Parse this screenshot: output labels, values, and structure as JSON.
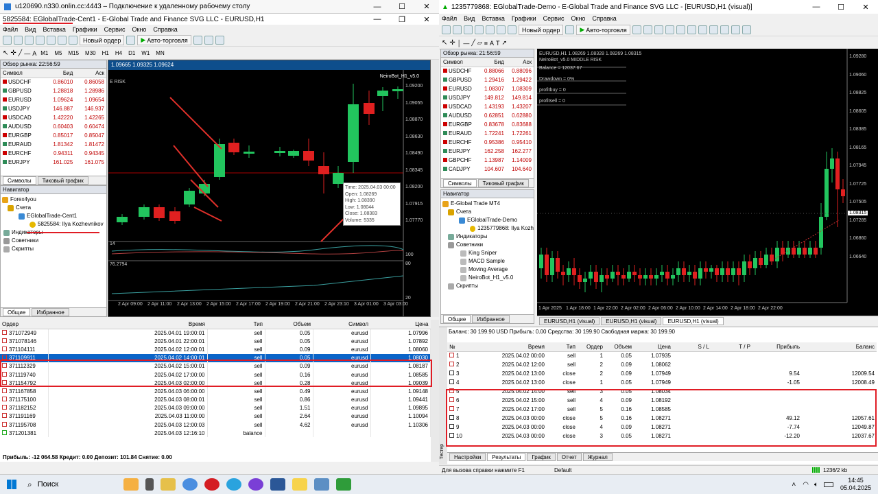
{
  "rdp": {
    "title": "u120690.n330.onlin.cc:4443 – Подключение к удаленному рабочему столу"
  },
  "left": {
    "title": "5825584: EGlobalTrade-Cent1 - E-Global Trade and Finance SVG LLC - EURUSD,H1",
    "menu": [
      "Файл",
      "Вид",
      "Вставка",
      "Графики",
      "Сервис",
      "Окно",
      "Справка"
    ],
    "new_order": "Новый ордер",
    "autotrade": "Авто-торговля",
    "timeframes": [
      "M1",
      "M5",
      "M15",
      "M30",
      "H1",
      "H4",
      "D1",
      "W1",
      "MN"
    ],
    "mw_header": "Обзор рынка: 22:56:59",
    "mw_cols": [
      "Символ",
      "Бид",
      "Аск"
    ],
    "mw_rows": [
      [
        "USDCHF",
        "0.86010",
        "0.86058"
      ],
      [
        "GBPUSD",
        "1.28818",
        "1.28986"
      ],
      [
        "EURUSD",
        "1.09624",
        "1.09654"
      ],
      [
        "USDJPY",
        "146.887",
        "146.937"
      ],
      [
        "USDCAD",
        "1.42220",
        "1.42265"
      ],
      [
        "AUDUSD",
        "0.60403",
        "0.60474"
      ],
      [
        "EURGBP",
        "0.85017",
        "0.85047"
      ],
      [
        "EURAUD",
        "1.81342",
        "1.81472"
      ],
      [
        "EURCHF",
        "0.94311",
        "0.94345"
      ],
      [
        "EURJPY",
        "161.025",
        "161.075"
      ]
    ],
    "mw_tabs": [
      "Символы",
      "Тиковый график"
    ],
    "nav_header": "Навигатор",
    "nav": [
      "Forex4you",
      "Счета",
      "EGlobalTrade-Cent1",
      "5825584: Ilya Kozhevnikov",
      "Индикаторы",
      "Советники",
      "Скрипты"
    ],
    "nav_tabs": [
      "Общие",
      "Избранное"
    ],
    "chart_header": "1.09665 1.09325 1.09624",
    "chart_risk": "E RISK",
    "chart_bot": "NeiroBot_H1_v5.0",
    "price_labels": [
      "1.09200",
      "1.09055",
      "1.08870",
      "1.08630",
      "1.08490",
      "1.08345",
      "1.08200",
      "1.07915",
      "1.07770",
      "100",
      "80",
      "20"
    ],
    "tooltip": [
      "Time: 2025.04.03 00:00",
      "Open: 1.08269",
      "High: 1.08390",
      "Low: 1.08044",
      "Close: 1.08383",
      "Volume: 5335"
    ],
    "ind_value": "76.2794",
    "ind_level": "14",
    "time_labels": [
      "2 Apr 09:00",
      "2 Apr 11:00",
      "2 Apr 13:00",
      "2 Apr 15:00",
      "2 Apr 17:00",
      "2 Apr 19:00",
      "2 Apr 21:00",
      "2 Apr 23:10",
      "3 Apr 01:00",
      "3 Apr 03:00"
    ],
    "orders_cols": [
      "Ордер",
      "Время",
      "Тип",
      "Объем",
      "Символ",
      "Цена"
    ],
    "orders": [
      [
        "371072949",
        "2025.04.01 19:00:01",
        "sell",
        "0.05",
        "eurusd",
        "1.07996"
      ],
      [
        "371078146",
        "2025.04.01 22:00:01",
        "sell",
        "0.05",
        "eurusd",
        "1.07892"
      ],
      [
        "371104111",
        "2025.04.02 12:00:01",
        "sell",
        "0.09",
        "eurusd",
        "1.08060"
      ],
      [
        "371109911",
        "2025.04.02 14:00:01",
        "sell",
        "0.05",
        "eurusd",
        "1.08030"
      ],
      [
        "371112329",
        "2025.04.02 15:00:01",
        "sell",
        "0.09",
        "eurusd",
        "1.08187"
      ],
      [
        "371119740",
        "2025.04.02 17:00:00",
        "sell",
        "0.16",
        "eurusd",
        "1.08585"
      ],
      [
        "371154792",
        "2025.04.03 02:00:00",
        "sell",
        "0.28",
        "eurusd",
        "1.09039"
      ],
      [
        "371167858",
        "2025.04.03 06:00:00",
        "sell",
        "0.49",
        "eurusd",
        "1.09148"
      ],
      [
        "371175100",
        "2025.04.03 08:00:01",
        "sell",
        "0.86",
        "eurusd",
        "1.09441"
      ],
      [
        "371182152",
        "2025.04.03 09:00:00",
        "sell",
        "1.51",
        "eurusd",
        "1.09895"
      ],
      [
        "371191169",
        "2025.04.03 11:00:00",
        "sell",
        "2.64",
        "eurusd",
        "1.10094"
      ],
      [
        "371195708",
        "2025.04.03 12:00:03",
        "sell",
        "4.62",
        "eurusd",
        "1.10306"
      ],
      [
        "371201381",
        "2025.04.03 12:16:10",
        "balance",
        "",
        "",
        ""
      ]
    ],
    "summary": "Прибыль: -12 064.58  Кредит: 0.00  Депозит: 101.84  Снятие: 0.00"
  },
  "right": {
    "title": "1235779868: EGlobalTrade-Demo - E-Global Trade and Finance SVG LLC - [EURUSD,H1 (visual)]",
    "menu": [
      "Файл",
      "Вид",
      "Вставка",
      "Графики",
      "Сервис",
      "Окно",
      "Справка"
    ],
    "new_order": "Новый ордер",
    "autotrade": "Авто-торговля",
    "mw_header": "Обзор рынка: 21:56:59",
    "mw_cols": [
      "Символ",
      "Бид",
      "Аск"
    ],
    "mw_rows": [
      [
        "USDCHF",
        "0.88066",
        "0.88096"
      ],
      [
        "GBPUSD",
        "1.29416",
        "1.29422"
      ],
      [
        "EURUSD",
        "1.08307",
        "1.08309"
      ],
      [
        "USDJPY",
        "149.812",
        "149.814"
      ],
      [
        "USDCAD",
        "1.43193",
        "1.43207"
      ],
      [
        "AUDUSD",
        "0.62851",
        "0.62880"
      ],
      [
        "EURGBP",
        "0.83678",
        "0.83688"
      ],
      [
        "EURAUD",
        "1.72241",
        "1.72261"
      ],
      [
        "EURCHF",
        "0.95386",
        "0.95410"
      ],
      [
        "EURJPY",
        "162.258",
        "162.277"
      ],
      [
        "GBPCHF",
        "1.13987",
        "1.14009"
      ],
      [
        "CADJPY",
        "104.607",
        "104.640"
      ]
    ],
    "mw_tabs": [
      "Символы",
      "Тиковый график"
    ],
    "nav_header": "Навигатор",
    "nav": [
      "E-Global Trade MT4",
      "Счета",
      "EGlobalTrade-Demo",
      "1235779868: Ilya Kozh",
      "Индикаторы",
      "Советники",
      "King Sniper",
      "MACD Sample",
      "Moving Average",
      "NeiroBot_H1_v5.0",
      "Скрипты"
    ],
    "nav_tabs": [
      "Общие",
      "Избранное"
    ],
    "chart_info": [
      "EURUSD,H1  1.08269 1.08328 1.08269 1.08315",
      "NeiroBot_v5.0 MIDDLE RISK",
      "Balance = 12037.67",
      "Drawdown = 0%",
      "profitbuy = 0",
      "profitsell = 0"
    ],
    "price_labels": [
      "1.09280",
      "1.09060",
      "1.08825",
      "1.08605",
      "1.08385",
      "1.08315",
      "1.08165",
      "1.07945",
      "1.07725",
      "1.07505",
      "1.07285",
      "1.06860",
      "1.06640"
    ],
    "price_labels2": [
      "1.09280",
      "1.09060",
      "1.08825",
      "1.08605",
      "1.08385",
      "1.08165",
      "1.07945",
      "1.07725",
      "1.07505",
      "1.07285",
      "1.06860",
      "1.06640"
    ],
    "time_labels": [
      "1 Apr 2025",
      "1 Apr 18:00",
      "1 Apr 22:00",
      "2 Apr 02:00",
      "2 Apr 06:00",
      "2 Apr 10:00",
      "2 Apr 14:00",
      "2 Apr 18:00",
      "2 Apr 22:00"
    ],
    "chart_tabs": [
      "EURUSD,H1 (visual)",
      "EURUSD,H1 (visual)",
      "EURUSD,H1 (visual)"
    ],
    "balance_line": "Баланс: 30 199.90 USD  Прибыль: 0.00  Средства: 30 199.90  Свободная маржа: 30 199.90",
    "results_cols": [
      "№",
      "Время",
      "Тип",
      "Ордер",
      "Объем",
      "Цена",
      "S / L",
      "T / P",
      "Прибыль",
      "Баланс"
    ],
    "results": [
      [
        "1",
        "2025.04.02 00:00",
        "sell",
        "1",
        "0.05",
        "1.07935",
        "",
        "",
        "",
        ""
      ],
      [
        "2",
        "2025.04.02 12:00",
        "sell",
        "2",
        "0.09",
        "1.08062",
        "",
        "",
        "",
        ""
      ],
      [
        "3",
        "2025.04.02 13:00",
        "close",
        "2",
        "0.09",
        "1.07949",
        "",
        "",
        "9.54",
        "12009.54"
      ],
      [
        "4",
        "2025.04.02 13:00",
        "close",
        "1",
        "0.05",
        "1.07949",
        "",
        "",
        "-1.05",
        "12008.49"
      ],
      [
        "5",
        "2025.04.02 14:00",
        "sell",
        "3",
        "0.05",
        "1.08034",
        "",
        "",
        "",
        ""
      ],
      [
        "6",
        "2025.04.02 15:00",
        "sell",
        "4",
        "0.09",
        "1.08192",
        "",
        "",
        "",
        ""
      ],
      [
        "7",
        "2025.04.02 17:00",
        "sell",
        "5",
        "0.16",
        "1.08585",
        "",
        "",
        "",
        ""
      ],
      [
        "8",
        "2025.04.03 00:00",
        "close",
        "5",
        "0.16",
        "1.08271",
        "",
        "",
        "49.12",
        "12057.61"
      ],
      [
        "9",
        "2025.04.03 00:00",
        "close",
        "4",
        "0.09",
        "1.08271",
        "",
        "",
        "-7.74",
        "12049.87"
      ],
      [
        "10",
        "2025.04.03 00:00",
        "close",
        "3",
        "0.05",
        "1.08271",
        "",
        "",
        "-12.20",
        "12037.67"
      ]
    ],
    "tester_label": "Тестер",
    "tester_tabs": [
      "Настройки",
      "Результаты",
      "График",
      "Отчет",
      "Журнал"
    ],
    "help": "Для вызова справки нажмите F1",
    "profile": "Default",
    "traffic": "1236/2 kb"
  },
  "taskbar": {
    "search": "Поиск",
    "time": "14:45",
    "date": "05.04.2025"
  }
}
